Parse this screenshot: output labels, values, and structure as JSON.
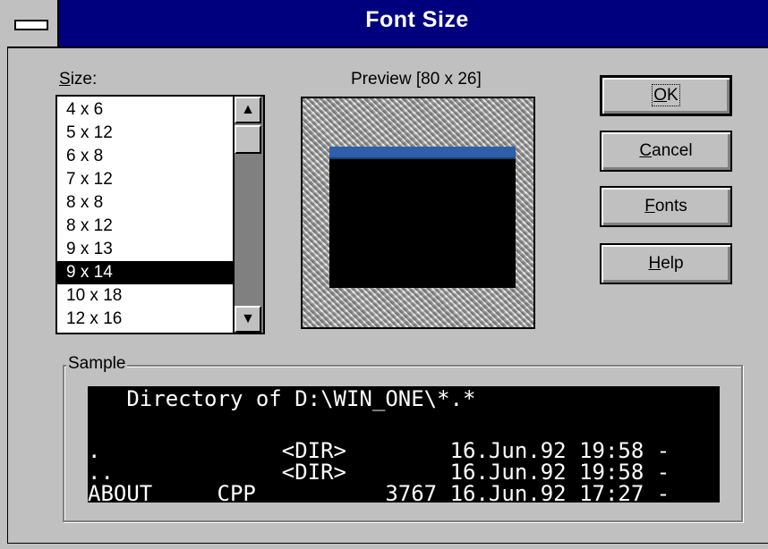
{
  "window": {
    "title": "Font Size",
    "colors": {
      "titlebar": "#00007f",
      "face": "#c0c0c0",
      "preview_bar": "#2f5fa8"
    }
  },
  "size": {
    "label_prefix": "S",
    "label_rest": "ize:",
    "items": [
      "4 x 6",
      "5 x 12",
      "6 x 8",
      "7 x 12",
      "8 x 8",
      "8 x 12",
      "9 x 13",
      "9 x 14",
      "10 x 18",
      "12 x 16"
    ],
    "selected": "9 x 14"
  },
  "preview": {
    "label": "Preview [80 x 26]"
  },
  "buttons": {
    "ok": {
      "mnemonic": "O",
      "rest": "K"
    },
    "cancel": {
      "mnemonic": "C",
      "rest": "ancel"
    },
    "fonts": {
      "mnemonic": "F",
      "rest": "onts"
    },
    "help": {
      "mnemonic": "H",
      "rest": "elp"
    }
  },
  "sample": {
    "label": "Sample",
    "lines": [
      "   Directory of D:\\WIN_ONE\\*.*",
      "",
      ".              <DIR>        16.Jun.92 19:58 -",
      "..             <DIR>        16.Jun.92 19:58 -",
      "ABOUT     CPP          3767 16.Jun.92 17:27 -"
    ]
  }
}
